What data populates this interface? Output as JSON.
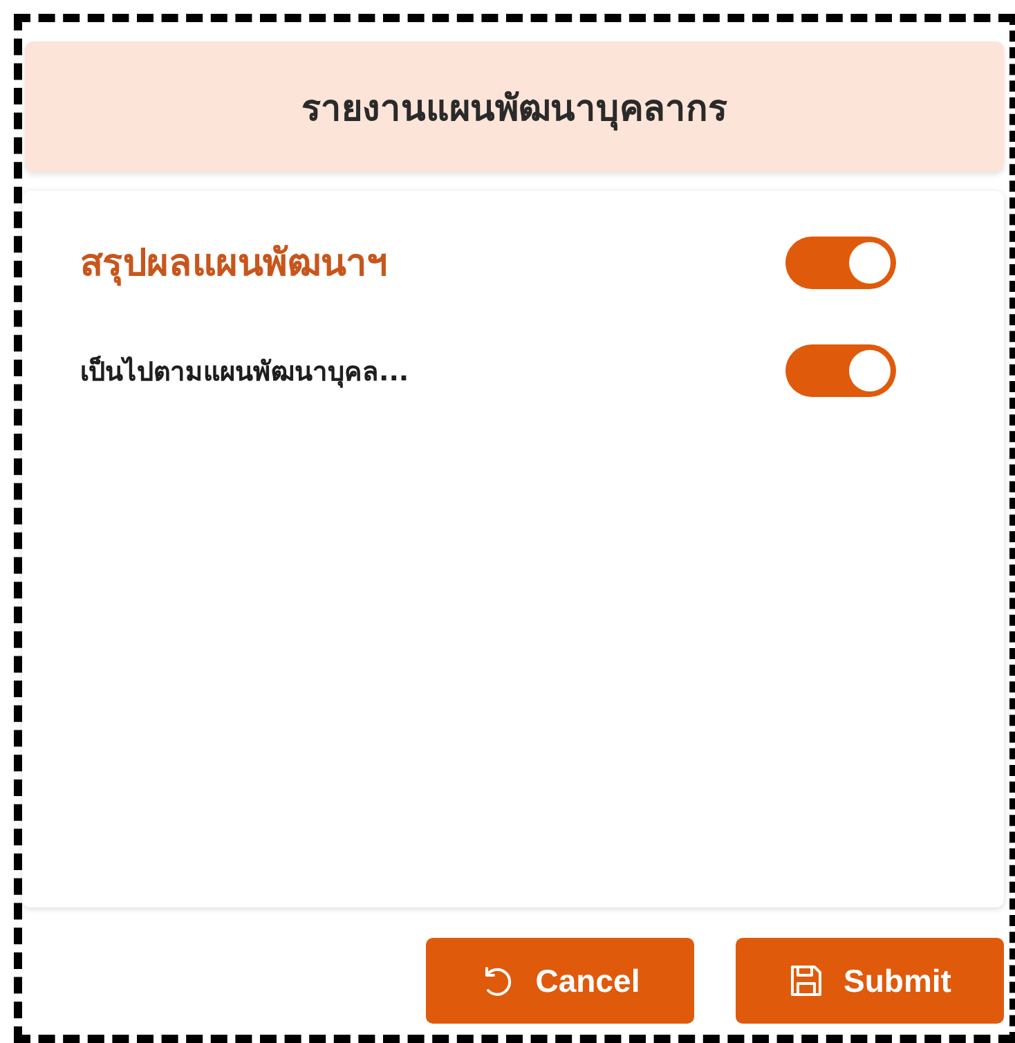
{
  "header": {
    "title": "รายงานแผนพัฒนาบุคลากร"
  },
  "rows": [
    {
      "kind": "heading",
      "label": "สรุปผลแผนพัฒนาฯ",
      "on": true
    },
    {
      "kind": "item",
      "label": "เป็นไปตามแผนพัฒนาบุคล...",
      "on": true
    }
  ],
  "buttons": [
    {
      "kind": "cancel",
      "label": "Cancel"
    },
    {
      "kind": "submit",
      "label": "Submit"
    }
  ]
}
